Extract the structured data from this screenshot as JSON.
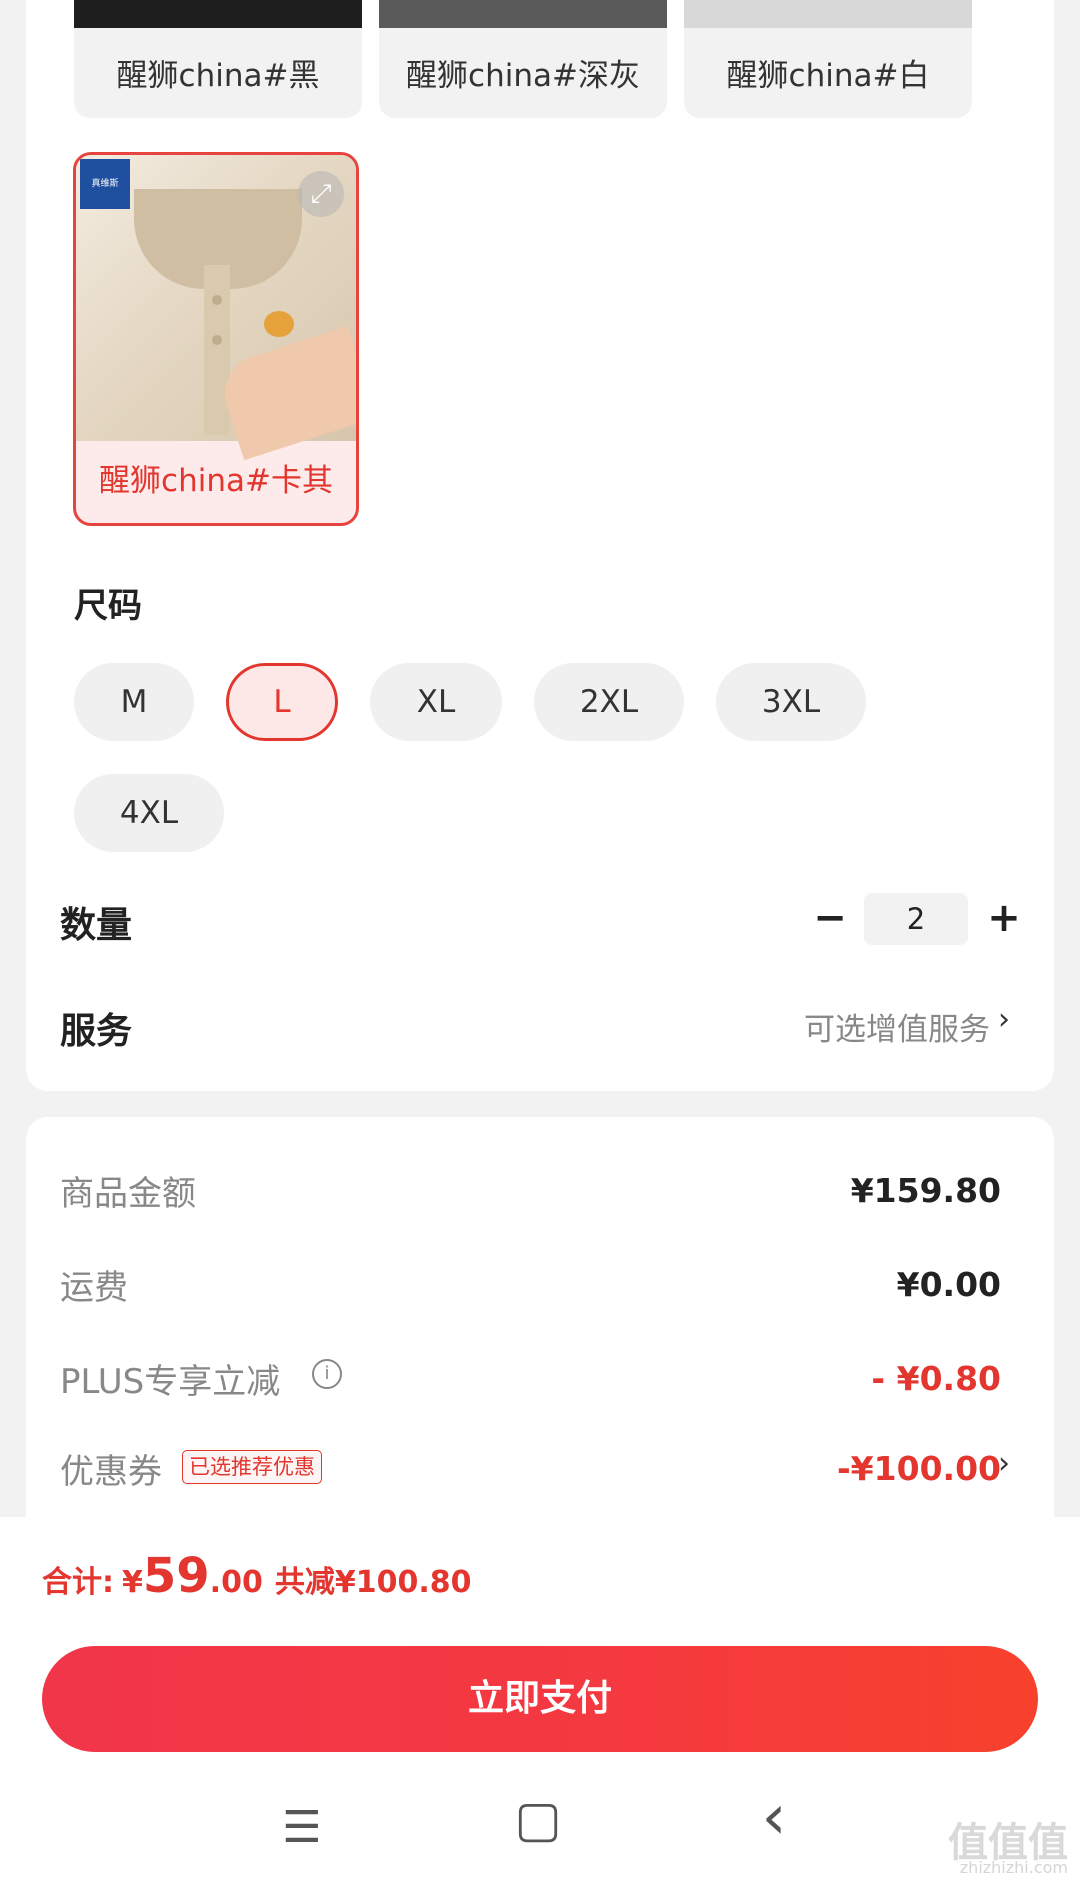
{
  "variants": [
    {
      "label": "醒狮china#黑",
      "thumb_color": "#1e1e1e"
    },
    {
      "label": "醒狮china#深灰",
      "thumb_color": "#5a5a5a"
    },
    {
      "label": "醒狮china#白",
      "thumb_color": "#d8d8d8"
    }
  ],
  "selected_variant": {
    "label": "醒狮china#卡其",
    "brand": "真维斯"
  },
  "size": {
    "title": "尺码",
    "options": [
      "M",
      "L",
      "XL",
      "2XL",
      "3XL",
      "4XL"
    ],
    "selected": "L"
  },
  "quantity": {
    "title": "数量",
    "minus": "−",
    "value": "2",
    "plus": "+"
  },
  "service": {
    "title": "服务",
    "hint": "可选增值服务",
    "chevron": "›"
  },
  "price": {
    "goods_label": "商品金额",
    "goods_value": "¥159.80",
    "shipping_label": "运费",
    "shipping_value": "¥0.00",
    "plus_label": "PLUS专享立减",
    "plus_value": "- ¥0.80",
    "coupon_label": "优惠券",
    "coupon_tag": "已选推荐优惠",
    "coupon_value": "-¥100.00"
  },
  "total": {
    "label": "合计:",
    "currency": "¥",
    "integer": "59",
    "decimal": ".00",
    "savings": "共减¥100.80"
  },
  "pay_button": "立即支付",
  "system_nav": {
    "menu": "☰",
    "home": "▢",
    "back": "‹"
  },
  "watermark": {
    "main": "值值值",
    "sub": "zhizhizhi.com"
  },
  "colors": {
    "accent": "#e2362f",
    "pay_button": "#f5393f"
  }
}
